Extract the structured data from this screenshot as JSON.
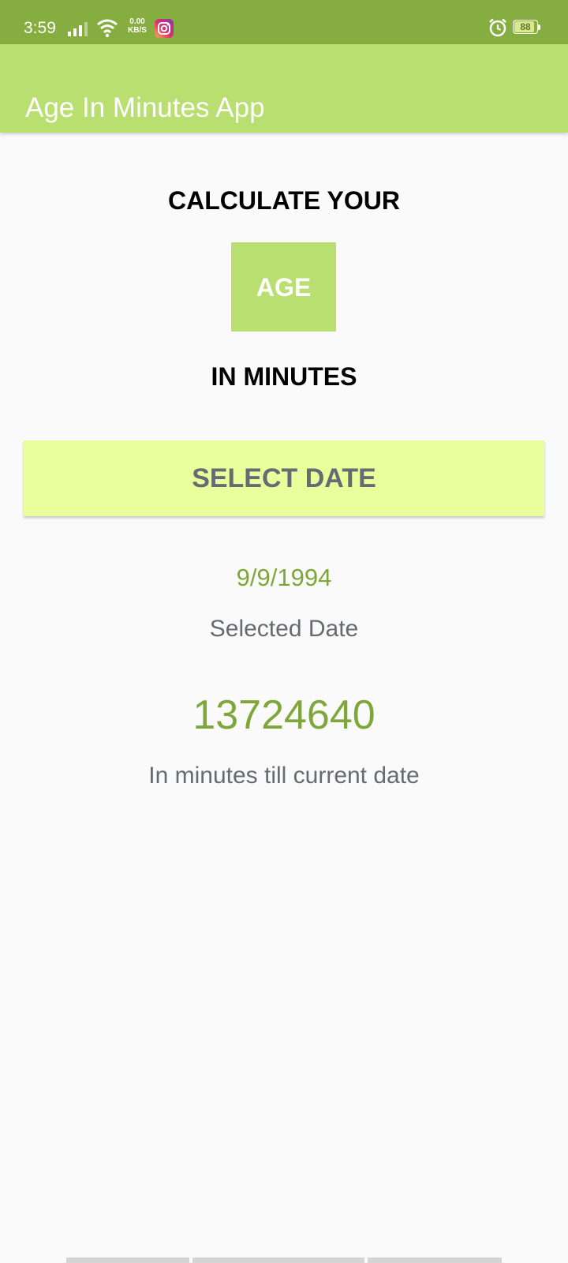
{
  "status_bar": {
    "time": "3:59",
    "net_speed_value": "0.00",
    "net_speed_unit": "KB/S",
    "battery_level": "88",
    "background_color": "#86ad3f",
    "icons": [
      "signal-icon",
      "wifi-icon",
      "instagram-icon",
      "alarm-icon",
      "battery-icon"
    ]
  },
  "app_bar": {
    "title": "Age In Minutes App",
    "color": "#b8df70"
  },
  "main": {
    "heading_top": "CALCULATE YOUR",
    "age_label": "AGE",
    "heading_bottom": "IN MINUTES",
    "select_button_label": "SELECT DATE",
    "select_button_color": "#e8ff9b",
    "selected_date_value": "9/9/1994",
    "selected_date_label": "Selected Date",
    "age_in_minutes_value": "13724640",
    "age_in_minutes_label": "In minutes till current date",
    "accent_value_color": "#7ea63b"
  }
}
